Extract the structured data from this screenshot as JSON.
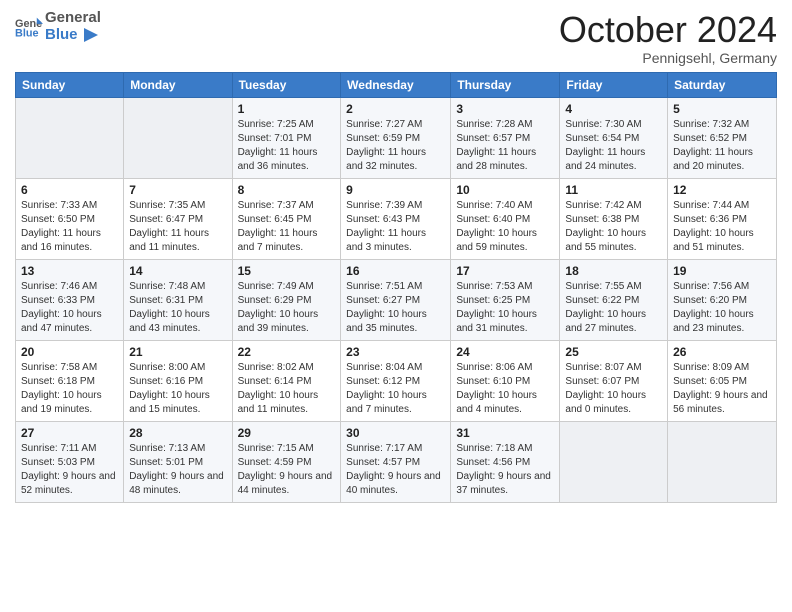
{
  "header": {
    "logo_text_general": "General",
    "logo_text_blue": "Blue",
    "month_title": "October 2024",
    "subtitle": "Pennigsehl, Germany"
  },
  "weekdays": [
    "Sunday",
    "Monday",
    "Tuesday",
    "Wednesday",
    "Thursday",
    "Friday",
    "Saturday"
  ],
  "weeks": [
    [
      {
        "day": "",
        "sunrise": "",
        "sunset": "",
        "daylight": "",
        "empty": true
      },
      {
        "day": "",
        "sunrise": "",
        "sunset": "",
        "daylight": "",
        "empty": true
      },
      {
        "day": "1",
        "sunrise": "Sunrise: 7:25 AM",
        "sunset": "Sunset: 7:01 PM",
        "daylight": "Daylight: 11 hours and 36 minutes."
      },
      {
        "day": "2",
        "sunrise": "Sunrise: 7:27 AM",
        "sunset": "Sunset: 6:59 PM",
        "daylight": "Daylight: 11 hours and 32 minutes."
      },
      {
        "day": "3",
        "sunrise": "Sunrise: 7:28 AM",
        "sunset": "Sunset: 6:57 PM",
        "daylight": "Daylight: 11 hours and 28 minutes."
      },
      {
        "day": "4",
        "sunrise": "Sunrise: 7:30 AM",
        "sunset": "Sunset: 6:54 PM",
        "daylight": "Daylight: 11 hours and 24 minutes."
      },
      {
        "day": "5",
        "sunrise": "Sunrise: 7:32 AM",
        "sunset": "Sunset: 6:52 PM",
        "daylight": "Daylight: 11 hours and 20 minutes."
      }
    ],
    [
      {
        "day": "6",
        "sunrise": "Sunrise: 7:33 AM",
        "sunset": "Sunset: 6:50 PM",
        "daylight": "Daylight: 11 hours and 16 minutes."
      },
      {
        "day": "7",
        "sunrise": "Sunrise: 7:35 AM",
        "sunset": "Sunset: 6:47 PM",
        "daylight": "Daylight: 11 hours and 11 minutes."
      },
      {
        "day": "8",
        "sunrise": "Sunrise: 7:37 AM",
        "sunset": "Sunset: 6:45 PM",
        "daylight": "Daylight: 11 hours and 7 minutes."
      },
      {
        "day": "9",
        "sunrise": "Sunrise: 7:39 AM",
        "sunset": "Sunset: 6:43 PM",
        "daylight": "Daylight: 11 hours and 3 minutes."
      },
      {
        "day": "10",
        "sunrise": "Sunrise: 7:40 AM",
        "sunset": "Sunset: 6:40 PM",
        "daylight": "Daylight: 10 hours and 59 minutes."
      },
      {
        "day": "11",
        "sunrise": "Sunrise: 7:42 AM",
        "sunset": "Sunset: 6:38 PM",
        "daylight": "Daylight: 10 hours and 55 minutes."
      },
      {
        "day": "12",
        "sunrise": "Sunrise: 7:44 AM",
        "sunset": "Sunset: 6:36 PM",
        "daylight": "Daylight: 10 hours and 51 minutes."
      }
    ],
    [
      {
        "day": "13",
        "sunrise": "Sunrise: 7:46 AM",
        "sunset": "Sunset: 6:33 PM",
        "daylight": "Daylight: 10 hours and 47 minutes."
      },
      {
        "day": "14",
        "sunrise": "Sunrise: 7:48 AM",
        "sunset": "Sunset: 6:31 PM",
        "daylight": "Daylight: 10 hours and 43 minutes."
      },
      {
        "day": "15",
        "sunrise": "Sunrise: 7:49 AM",
        "sunset": "Sunset: 6:29 PM",
        "daylight": "Daylight: 10 hours and 39 minutes."
      },
      {
        "day": "16",
        "sunrise": "Sunrise: 7:51 AM",
        "sunset": "Sunset: 6:27 PM",
        "daylight": "Daylight: 10 hours and 35 minutes."
      },
      {
        "day": "17",
        "sunrise": "Sunrise: 7:53 AM",
        "sunset": "Sunset: 6:25 PM",
        "daylight": "Daylight: 10 hours and 31 minutes."
      },
      {
        "day": "18",
        "sunrise": "Sunrise: 7:55 AM",
        "sunset": "Sunset: 6:22 PM",
        "daylight": "Daylight: 10 hours and 27 minutes."
      },
      {
        "day": "19",
        "sunrise": "Sunrise: 7:56 AM",
        "sunset": "Sunset: 6:20 PM",
        "daylight": "Daylight: 10 hours and 23 minutes."
      }
    ],
    [
      {
        "day": "20",
        "sunrise": "Sunrise: 7:58 AM",
        "sunset": "Sunset: 6:18 PM",
        "daylight": "Daylight: 10 hours and 19 minutes."
      },
      {
        "day": "21",
        "sunrise": "Sunrise: 8:00 AM",
        "sunset": "Sunset: 6:16 PM",
        "daylight": "Daylight: 10 hours and 15 minutes."
      },
      {
        "day": "22",
        "sunrise": "Sunrise: 8:02 AM",
        "sunset": "Sunset: 6:14 PM",
        "daylight": "Daylight: 10 hours and 11 minutes."
      },
      {
        "day": "23",
        "sunrise": "Sunrise: 8:04 AM",
        "sunset": "Sunset: 6:12 PM",
        "daylight": "Daylight: 10 hours and 7 minutes."
      },
      {
        "day": "24",
        "sunrise": "Sunrise: 8:06 AM",
        "sunset": "Sunset: 6:10 PM",
        "daylight": "Daylight: 10 hours and 4 minutes."
      },
      {
        "day": "25",
        "sunrise": "Sunrise: 8:07 AM",
        "sunset": "Sunset: 6:07 PM",
        "daylight": "Daylight: 10 hours and 0 minutes."
      },
      {
        "day": "26",
        "sunrise": "Sunrise: 8:09 AM",
        "sunset": "Sunset: 6:05 PM",
        "daylight": "Daylight: 9 hours and 56 minutes."
      }
    ],
    [
      {
        "day": "27",
        "sunrise": "Sunrise: 7:11 AM",
        "sunset": "Sunset: 5:03 PM",
        "daylight": "Daylight: 9 hours and 52 minutes."
      },
      {
        "day": "28",
        "sunrise": "Sunrise: 7:13 AM",
        "sunset": "Sunset: 5:01 PM",
        "daylight": "Daylight: 9 hours and 48 minutes."
      },
      {
        "day": "29",
        "sunrise": "Sunrise: 7:15 AM",
        "sunset": "Sunset: 4:59 PM",
        "daylight": "Daylight: 9 hours and 44 minutes."
      },
      {
        "day": "30",
        "sunrise": "Sunrise: 7:17 AM",
        "sunset": "Sunset: 4:57 PM",
        "daylight": "Daylight: 9 hours and 40 minutes."
      },
      {
        "day": "31",
        "sunrise": "Sunrise: 7:18 AM",
        "sunset": "Sunset: 4:56 PM",
        "daylight": "Daylight: 9 hours and 37 minutes."
      },
      {
        "day": "",
        "sunrise": "",
        "sunset": "",
        "daylight": "",
        "empty": true
      },
      {
        "day": "",
        "sunrise": "",
        "sunset": "",
        "daylight": "",
        "empty": true
      }
    ]
  ]
}
